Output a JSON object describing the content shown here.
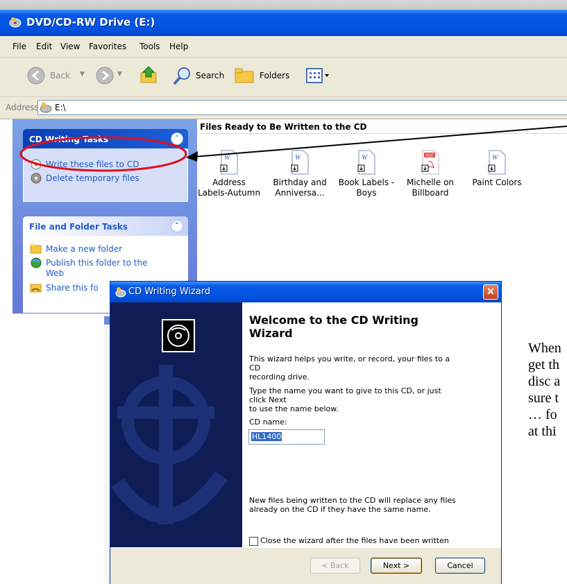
{
  "explorer": {
    "title": "DVD/CD-RW Drive (E:)",
    "menu": [
      "File",
      "Edit",
      "View",
      "Favorites",
      "Tools",
      "Help"
    ],
    "toolbar": {
      "back": "Back",
      "search": "Search",
      "folders": "Folders"
    },
    "address": {
      "label": "Address",
      "value": "E:\\"
    },
    "cd_tasks": {
      "title": "CD Writing Tasks",
      "items": [
        "Write these files to CD",
        "Delete temporary files"
      ]
    },
    "file_tasks": {
      "title": "File and Folder Tasks",
      "items": [
        "Make a new folder",
        "Publish this folder to the Web",
        "Share this fo"
      ]
    },
    "files_header": "Files Ready to Be Written to the CD",
    "files": [
      {
        "line1": "Address",
        "line2": "Labels-Autumn",
        "icon": "word-doc-icon"
      },
      {
        "line1": "Birthday and",
        "line2": "Anniversa...",
        "icon": "word-doc-icon"
      },
      {
        "line1": "Book Labels -",
        "line2": "Boys",
        "icon": "word-doc-icon"
      },
      {
        "line1": "Michelle on",
        "line2": "Billboard",
        "icon": "pdf-icon"
      },
      {
        "line1": "Paint Colors",
        "line2": "",
        "icon": "word-doc-icon"
      }
    ]
  },
  "wizard": {
    "title": "CD Writing Wizard",
    "heading_line1": "Welcome to the CD Writing",
    "heading_line2": "Wizard",
    "intro_line1": "This wizard helps you write, or record, your files to a CD",
    "intro_line2": "recording drive.",
    "instr_line1": "Type the name you want to give to this CD, or just click Next",
    "instr_line2": "to use the name below.",
    "cd_name_label": "CD name:",
    "cd_name_value": "HL1400",
    "note_line1": "New files being written to the CD will replace any files",
    "note_line2": "already on the CD if they have the same name.",
    "close_checkbox_label": "Close the wizard after the files have been written",
    "close_checkbox_checked": false,
    "buttons": {
      "back": "< Back",
      "next": "Next >",
      "cancel": "Cancel"
    }
  },
  "caption_lines": [
    "When",
    "get th",
    "disc a",
    "sure t",
    "… fo",
    "at thi"
  ],
  "colors": {
    "xp_blue": "#0054e3",
    "task_link": "#215dc6",
    "annotation_red": "#e0101e"
  }
}
